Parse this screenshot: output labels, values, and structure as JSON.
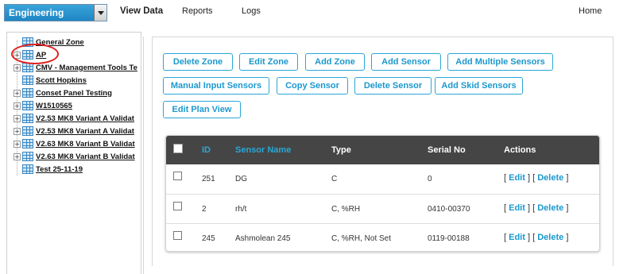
{
  "header": {
    "department": "Engineering",
    "nav": [
      "View Data",
      "Reports",
      "Logs"
    ],
    "home": "Home"
  },
  "tree": {
    "items": [
      {
        "label": "General Zone",
        "expandable": false
      },
      {
        "label": "AP",
        "expandable": true
      },
      {
        "label": "CMV - Management Tools Te",
        "expandable": true
      },
      {
        "label": "Scott Hopkins",
        "expandable": false
      },
      {
        "label": "Conset Panel Testing",
        "expandable": true
      },
      {
        "label": "W1510565",
        "expandable": true
      },
      {
        "label": "V2.53 MK8 Variant A Validat",
        "expandable": true
      },
      {
        "label": "V2.53 MK8 Variant A Validat",
        "expandable": true
      },
      {
        "label": "V2.63 MK8 Variant B Validat",
        "expandable": true
      },
      {
        "label": "V2.63 MK8 Variant B Validat",
        "expandable": true
      },
      {
        "label": "Test 25-11-19",
        "expandable": false
      }
    ],
    "expand_symbol": "+"
  },
  "toolbar": {
    "delete_zone": "Delete Zone",
    "edit_zone": "Edit Zone",
    "add_zone": "Add Zone",
    "add_sensor": "Add Sensor",
    "add_multiple_sensors": "Add Multiple Sensors",
    "manual_input_sensors": "Manual Input Sensors",
    "copy_sensor": "Copy Sensor",
    "delete_sensor": "Delete Sensor",
    "add_skid_sensors": "Add Skid Sensors",
    "edit_plan_view": "Edit Plan View"
  },
  "table": {
    "headers": {
      "id": "ID",
      "sensor_name": "Sensor Name",
      "type": "Type",
      "serial_no": "Serial No",
      "actions": "Actions"
    },
    "rows": [
      {
        "id": "251",
        "name": "DG",
        "type": "C",
        "serial": "0",
        "edit": "Edit",
        "delete": "Delete"
      },
      {
        "id": "2",
        "name": "rh/t",
        "type": "C, %RH",
        "serial": "0410-00370",
        "edit": "Edit",
        "delete": "Delete"
      },
      {
        "id": "245",
        "name": "Ashmolean 245",
        "type": "C, %RH, Not Set",
        "serial": "0119-00188",
        "edit": "Edit",
        "delete": "Delete"
      }
    ],
    "bracket_open": "[",
    "bracket_close": "]"
  },
  "colors": {
    "accent": "#1b98cd",
    "header_dark": "#454545",
    "highlight_circle": "#e0201f"
  }
}
